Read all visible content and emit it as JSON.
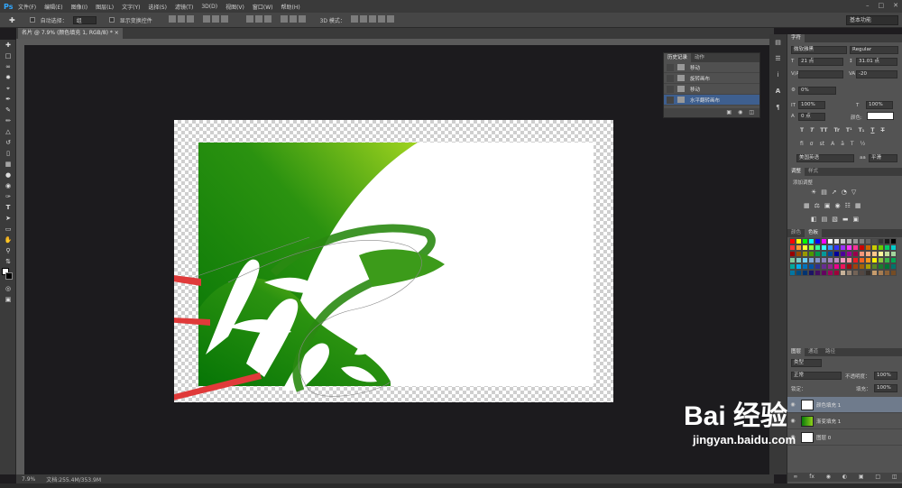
{
  "app": {
    "logo": "Ps"
  },
  "menu": [
    "文件(F)",
    "编辑(E)",
    "图像(I)",
    "图层(L)",
    "文字(Y)",
    "选择(S)",
    "滤镜(T)",
    "3D(D)",
    "视图(V)",
    "窗口(W)",
    "帮助(H)"
  ],
  "options": {
    "auto_select": "自动选择：",
    "auto_select_value": "组",
    "show_transform": "显示变换控件",
    "mode_3d": "3D 模式：",
    "workspace": "基本功能"
  },
  "document": {
    "tab_title": "名片 @ 7.9% (颜色填充 1, RGB/8) *"
  },
  "status": {
    "zoom": "7.9%",
    "doc_info": "文档:255.4M/353.9M"
  },
  "history": {
    "tabs": [
      "历史记录",
      "动作"
    ],
    "items": [
      "移动",
      "旋转画布",
      "移动",
      "水平翻转画布"
    ],
    "selected_index": 3
  },
  "character": {
    "tab": "字符",
    "font_family": "微软雅黑",
    "font_style": "Regular",
    "size": "21 点",
    "leading": "31.01 点",
    "tracking": "-20",
    "scale_tracking": "0%",
    "vscale": "100%",
    "hscale": "100%",
    "baseline": "0 点",
    "color_label": "颜色:",
    "language": "美国英语",
    "aa_label": "aa",
    "aa_value": "平滑"
  },
  "adjustments": {
    "tabs": [
      "调整",
      "样式"
    ],
    "add_label": "添加调整"
  },
  "swatches": {
    "tabs": [
      "颜色",
      "色板"
    ],
    "colors": [
      "#ff0000",
      "#ffff00",
      "#00ff00",
      "#00ffff",
      "#0000ff",
      "#ff00ff",
      "#ffffff",
      "#e6e6e6",
      "#cccccc",
      "#b3b3b3",
      "#999999",
      "#808080",
      "#666666",
      "#4d4d4d",
      "#333333",
      "#1a1a1a",
      "#000000",
      "#ff3333",
      "#ff9933",
      "#ffff33",
      "#99ff33",
      "#33ff99",
      "#33ffff",
      "#3399ff",
      "#3333ff",
      "#9933ff",
      "#ff33ff",
      "#ff3399",
      "#cc0000",
      "#cc6600",
      "#cccc00",
      "#66cc00",
      "#00cc66",
      "#00cccc",
      "#990000",
      "#994c00",
      "#999900",
      "#4c9900",
      "#00994c",
      "#009999",
      "#004c99",
      "#000099",
      "#4c0099",
      "#990099",
      "#99004c",
      "#f7977a",
      "#fbad82",
      "#fdc68c",
      "#fff79a",
      "#c4df9b",
      "#a2d39c",
      "#82ca9c",
      "#7bcdc8",
      "#6ecff6",
      "#7ea7d8",
      "#8493ca",
      "#8882be",
      "#a187be",
      "#bc8dbf",
      "#f49ac2",
      "#f6989d",
      "#ed1c24",
      "#f26522",
      "#f7941d",
      "#fff200",
      "#8dc63f",
      "#39b54a",
      "#00a651",
      "#00a99d",
      "#00aeef",
      "#0072bc",
      "#0054a6",
      "#2e3192",
      "#662d91",
      "#92278f",
      "#ec008c",
      "#ed145b",
      "#9e0b0f",
      "#a0410d",
      "#a36209",
      "#aba000",
      "#598527",
      "#1a7b30",
      "#007236",
      "#00746b",
      "#0076a3",
      "#004b80",
      "#003471",
      "#1b1464",
      "#440e62",
      "#630460",
      "#9e005d",
      "#9e0039",
      "#c7b299",
      "#998675",
      "#736357",
      "#534741",
      "#37302a",
      "#c69c6d",
      "#a67c52",
      "#8c6239",
      "#754c24"
    ]
  },
  "layers": {
    "tabs": [
      "图层",
      "通道",
      "路径"
    ],
    "kind": "类型",
    "blend": "正常",
    "opacity_label": "不透明度：",
    "opacity": "100%",
    "lock_label": "锁定：",
    "fill_label": "填充：",
    "fill": "100%",
    "items": [
      "颜色填充 1",
      "渐变填充 1",
      "图层 0"
    ]
  },
  "watermark": {
    "main": "Bai 经验",
    "sub": "jingyan.baidu.com"
  },
  "colors": {
    "accent": "#31a8ff",
    "green_dark": "#0a7a0a",
    "green_light": "#8fd11a",
    "arrow_red": "#e03a3a"
  }
}
